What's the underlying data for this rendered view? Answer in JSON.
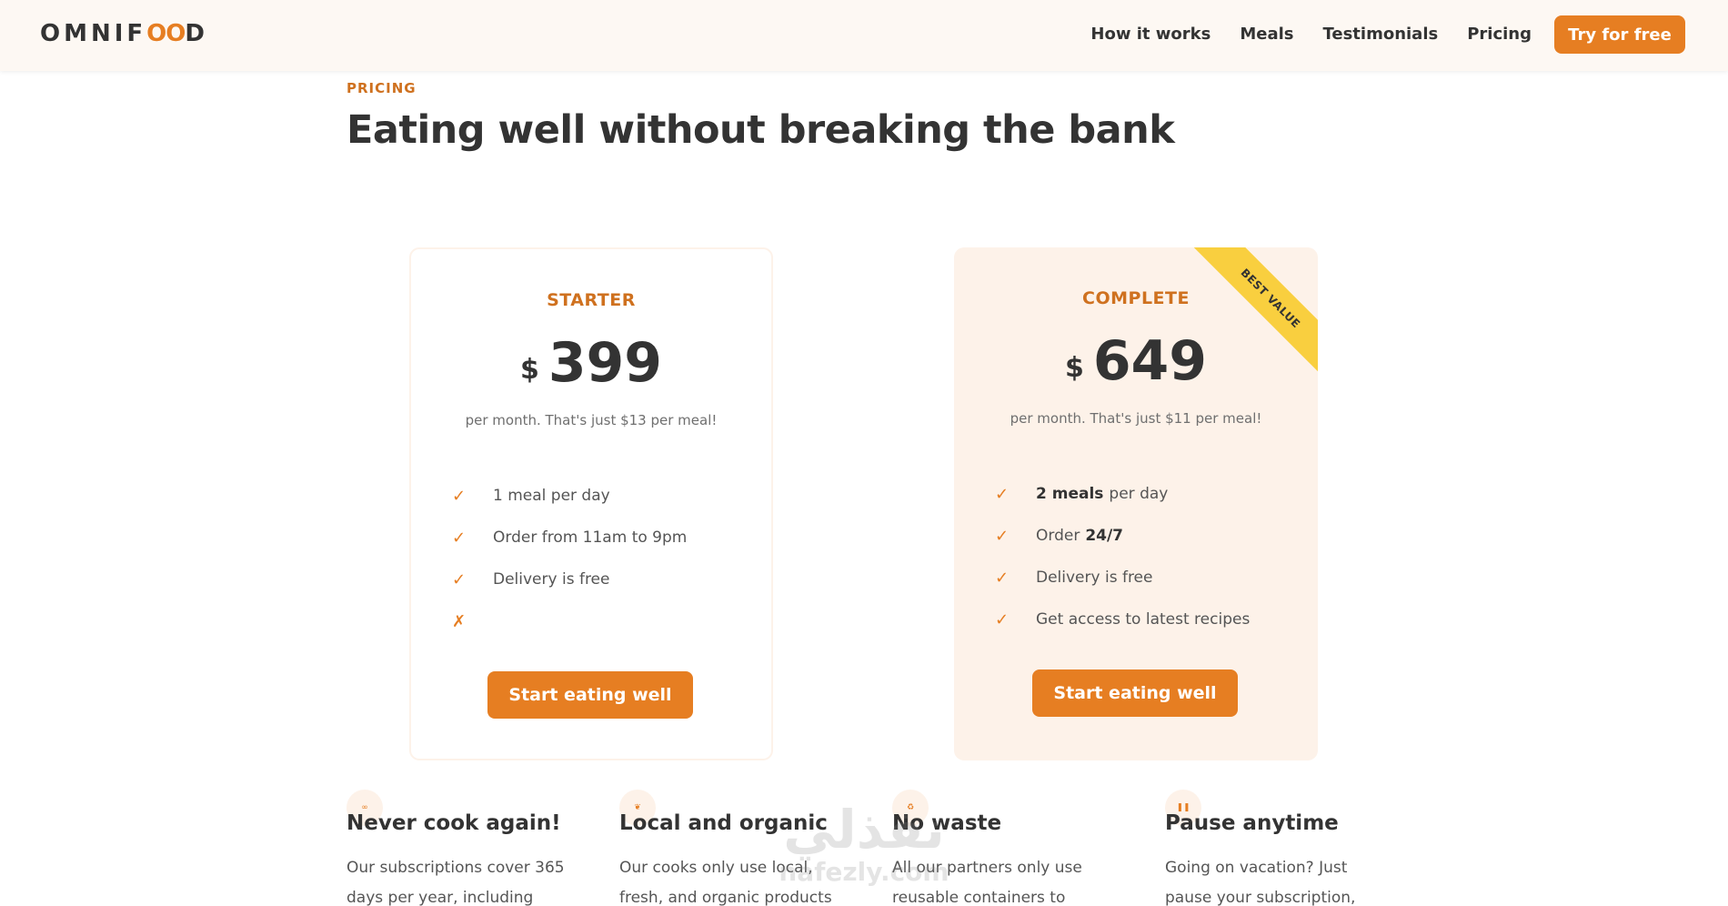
{
  "header": {
    "logo_left": "OMNIF",
    "logo_oo": "OO",
    "logo_right": "D",
    "nav": [
      "How it works",
      "Meals",
      "Testimonials",
      "Pricing"
    ],
    "cta": "Try for free"
  },
  "section": {
    "subheading": "PRICING",
    "heading": "Eating well without breaking the bank"
  },
  "plans": [
    {
      "name": "STARTER",
      "currency": "$",
      "price": "399",
      "per_meal": "per month. That's just $13 per meal!",
      "features": [
        {
          "mark": "✓",
          "bold": "",
          "text": "1 meal per day"
        },
        {
          "mark": "✓",
          "bold": "",
          "text": "Order from 11am to 9pm"
        },
        {
          "mark": "✓",
          "bold": "",
          "text": "Delivery is free"
        },
        {
          "mark": "✗",
          "bold": "",
          "text": ""
        }
      ],
      "button": "Start eating well"
    },
    {
      "name": "COMPLETE",
      "ribbon": "BEST VALUE",
      "currency": "$",
      "price": "649",
      "per_meal": "per month. That's just $11 per meal!",
      "features": [
        {
          "mark": "✓",
          "bold": "2 meals",
          "text": "per day"
        },
        {
          "mark": "✓",
          "bold": "",
          "text": "Order"
        },
        {
          "mark": "✓",
          "bold": "",
          "text": "Delivery is free"
        },
        {
          "mark": "✓",
          "bold": "",
          "text": "Get access to latest recipes"
        }
      ],
      "feature2_bold_suffix": "24/7",
      "button": "Start eating well"
    }
  ],
  "features_row": [
    {
      "icon": "infinity-icon",
      "title": "Never cook again!",
      "text": "Our subscriptions cover 365 days per year, including"
    },
    {
      "icon": "leaf-icon",
      "title": "Local and organic",
      "text": "Our cooks only use local, fresh, and organic products"
    },
    {
      "icon": "recycle-icon",
      "title": "No waste",
      "text": "All our partners only use reusable containers to"
    },
    {
      "icon": "pause-icon",
      "title": "Pause anytime",
      "text": "Going on vacation? Just pause your subscription,"
    }
  ],
  "watermark": {
    "arabic": "نفذلي",
    "latin": "nafezly.com"
  },
  "colors": {
    "accent": "#e67e22",
    "accent_dark": "#cf711f",
    "tint": "#fdf2e9",
    "ribbon": "#f9cf3f",
    "text": "#333333"
  }
}
